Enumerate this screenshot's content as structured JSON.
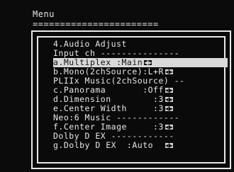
{
  "menu": {
    "title": "Menu",
    "divider": "======================="
  },
  "panel": {
    "heading": "4.Audio Adjust",
    "lines": [
      {
        "text": "Input ch ---------------",
        "selected": false,
        "arrows": false
      },
      {
        "text": "a.Multiplex :Main",
        "selected": true,
        "arrows": true
      },
      {
        "text": "b.Mono(2chSource):L+R",
        "selected": false,
        "arrows": true
      },
      {
        "text": "PLIIx Music(2chSource) --",
        "selected": false,
        "arrows": false
      },
      {
        "text": "c.Panorama       :Off",
        "selected": false,
        "arrows": true
      },
      {
        "text": "d.Dimension        :3",
        "selected": false,
        "arrows": true
      },
      {
        "text": "e.Center Width     :3",
        "selected": false,
        "arrows": true
      },
      {
        "text": "Neo:6 Music ------------",
        "selected": false,
        "arrows": false
      },
      {
        "text": "f.Center Image     :3",
        "selected": false,
        "arrows": true
      },
      {
        "text": "Dolby D EX ------------",
        "selected": false,
        "arrows": false
      },
      {
        "text": "g.Dolby D EX  :Auto  ",
        "selected": false,
        "arrows": true
      }
    ]
  },
  "colors": {
    "text": "#e6e6e6",
    "highlight": "#d9d9d9",
    "background": "#0b0b0b"
  },
  "icons": {
    "arrow_pair": "left-right-arrow-icon"
  }
}
